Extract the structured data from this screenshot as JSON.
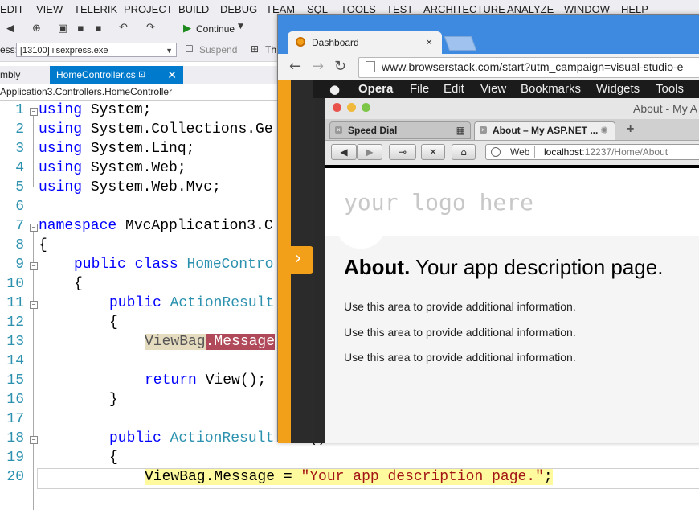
{
  "vs": {
    "menu": [
      "EDIT",
      "VIEW",
      "TELERIK",
      "PROJECT",
      "BUILD",
      "DEBUG",
      "TEAM",
      "SQL",
      "TOOLS",
      "TEST",
      "ARCHITECTURE",
      "ANALYZE",
      "WINDOW",
      "HELP"
    ],
    "toolbar": {
      "continue_label": "Continue",
      "process_label": "ess:",
      "process_value": "[13100] iisexpress.exe",
      "suspend_label": "Suspend",
      "thread_label": "Th"
    },
    "tabs": {
      "inactive": "mbly",
      "active": "HomeController.cs"
    },
    "nav_path": "Application3.Controllers.HomeController",
    "line_numbers": [
      "1",
      "2",
      "3",
      "4",
      "5",
      "6",
      "7",
      "8",
      "9",
      "10",
      "11",
      "12",
      "13",
      "14",
      "15",
      "16",
      "17",
      "18",
      "19",
      "20"
    ],
    "code": {
      "l1_kw": "using",
      "l1_rest": " System;",
      "l2_kw": "using",
      "l2_rest": " System.Collections.Ge",
      "l3_kw": "using",
      "l3_rest": " System.Linq;",
      "l4_kw": "using",
      "l4_rest": " System.Web;",
      "l5_kw": "using",
      "l5_rest": " System.Web.Mvc;",
      "l7_kw": "namespace",
      "l7_rest": " MvcApplication3.C",
      "l8": "{",
      "l9_kw": "public class",
      "l9_ty": "HomeContro",
      "l10": "{",
      "l11_kw": "public",
      "l11_ty": "ActionResult",
      "l12": "{",
      "l13_a": "ViewBag",
      "l13_b": ".Message",
      "l15_kw": "return",
      "l15_rest": " View();",
      "l16": "}",
      "l18_kw": "public",
      "l18_ty": "ActionResult",
      "l18_rest": "    ()",
      "l19": "{",
      "l20_a": "ViewBag",
      "l20_b": ".Message = ",
      "l20_str": "\"Your app description page.\"",
      "l20_end": ";"
    }
  },
  "browser": {
    "tab_title": "Dashboard",
    "url": "www.browserstack.com/start?utm_campaign=visual-studio-e"
  },
  "opera": {
    "menu": [
      "Opera",
      "File",
      "Edit",
      "View",
      "Bookmarks",
      "Widgets",
      "Tools"
    ],
    "window_title": "About - My A",
    "tabs": [
      "Speed Dial",
      "About – My ASP.NET ..."
    ],
    "address_label": "Web",
    "address_host": "localhost",
    "address_rest": ":12237/Home/About"
  },
  "page": {
    "logo": "your logo here",
    "heading_bold": "About.",
    "heading_rest": " Your app description page.",
    "paragraphs": [
      "Use this area to provide additional information.",
      "Use this area to provide additional information.",
      "Use this area to provide additional information."
    ]
  },
  "colors": {
    "vs_accent": "#007acc",
    "browserstack_orange": "#f29f1a",
    "chrome_blue": "#3d8ae0"
  }
}
